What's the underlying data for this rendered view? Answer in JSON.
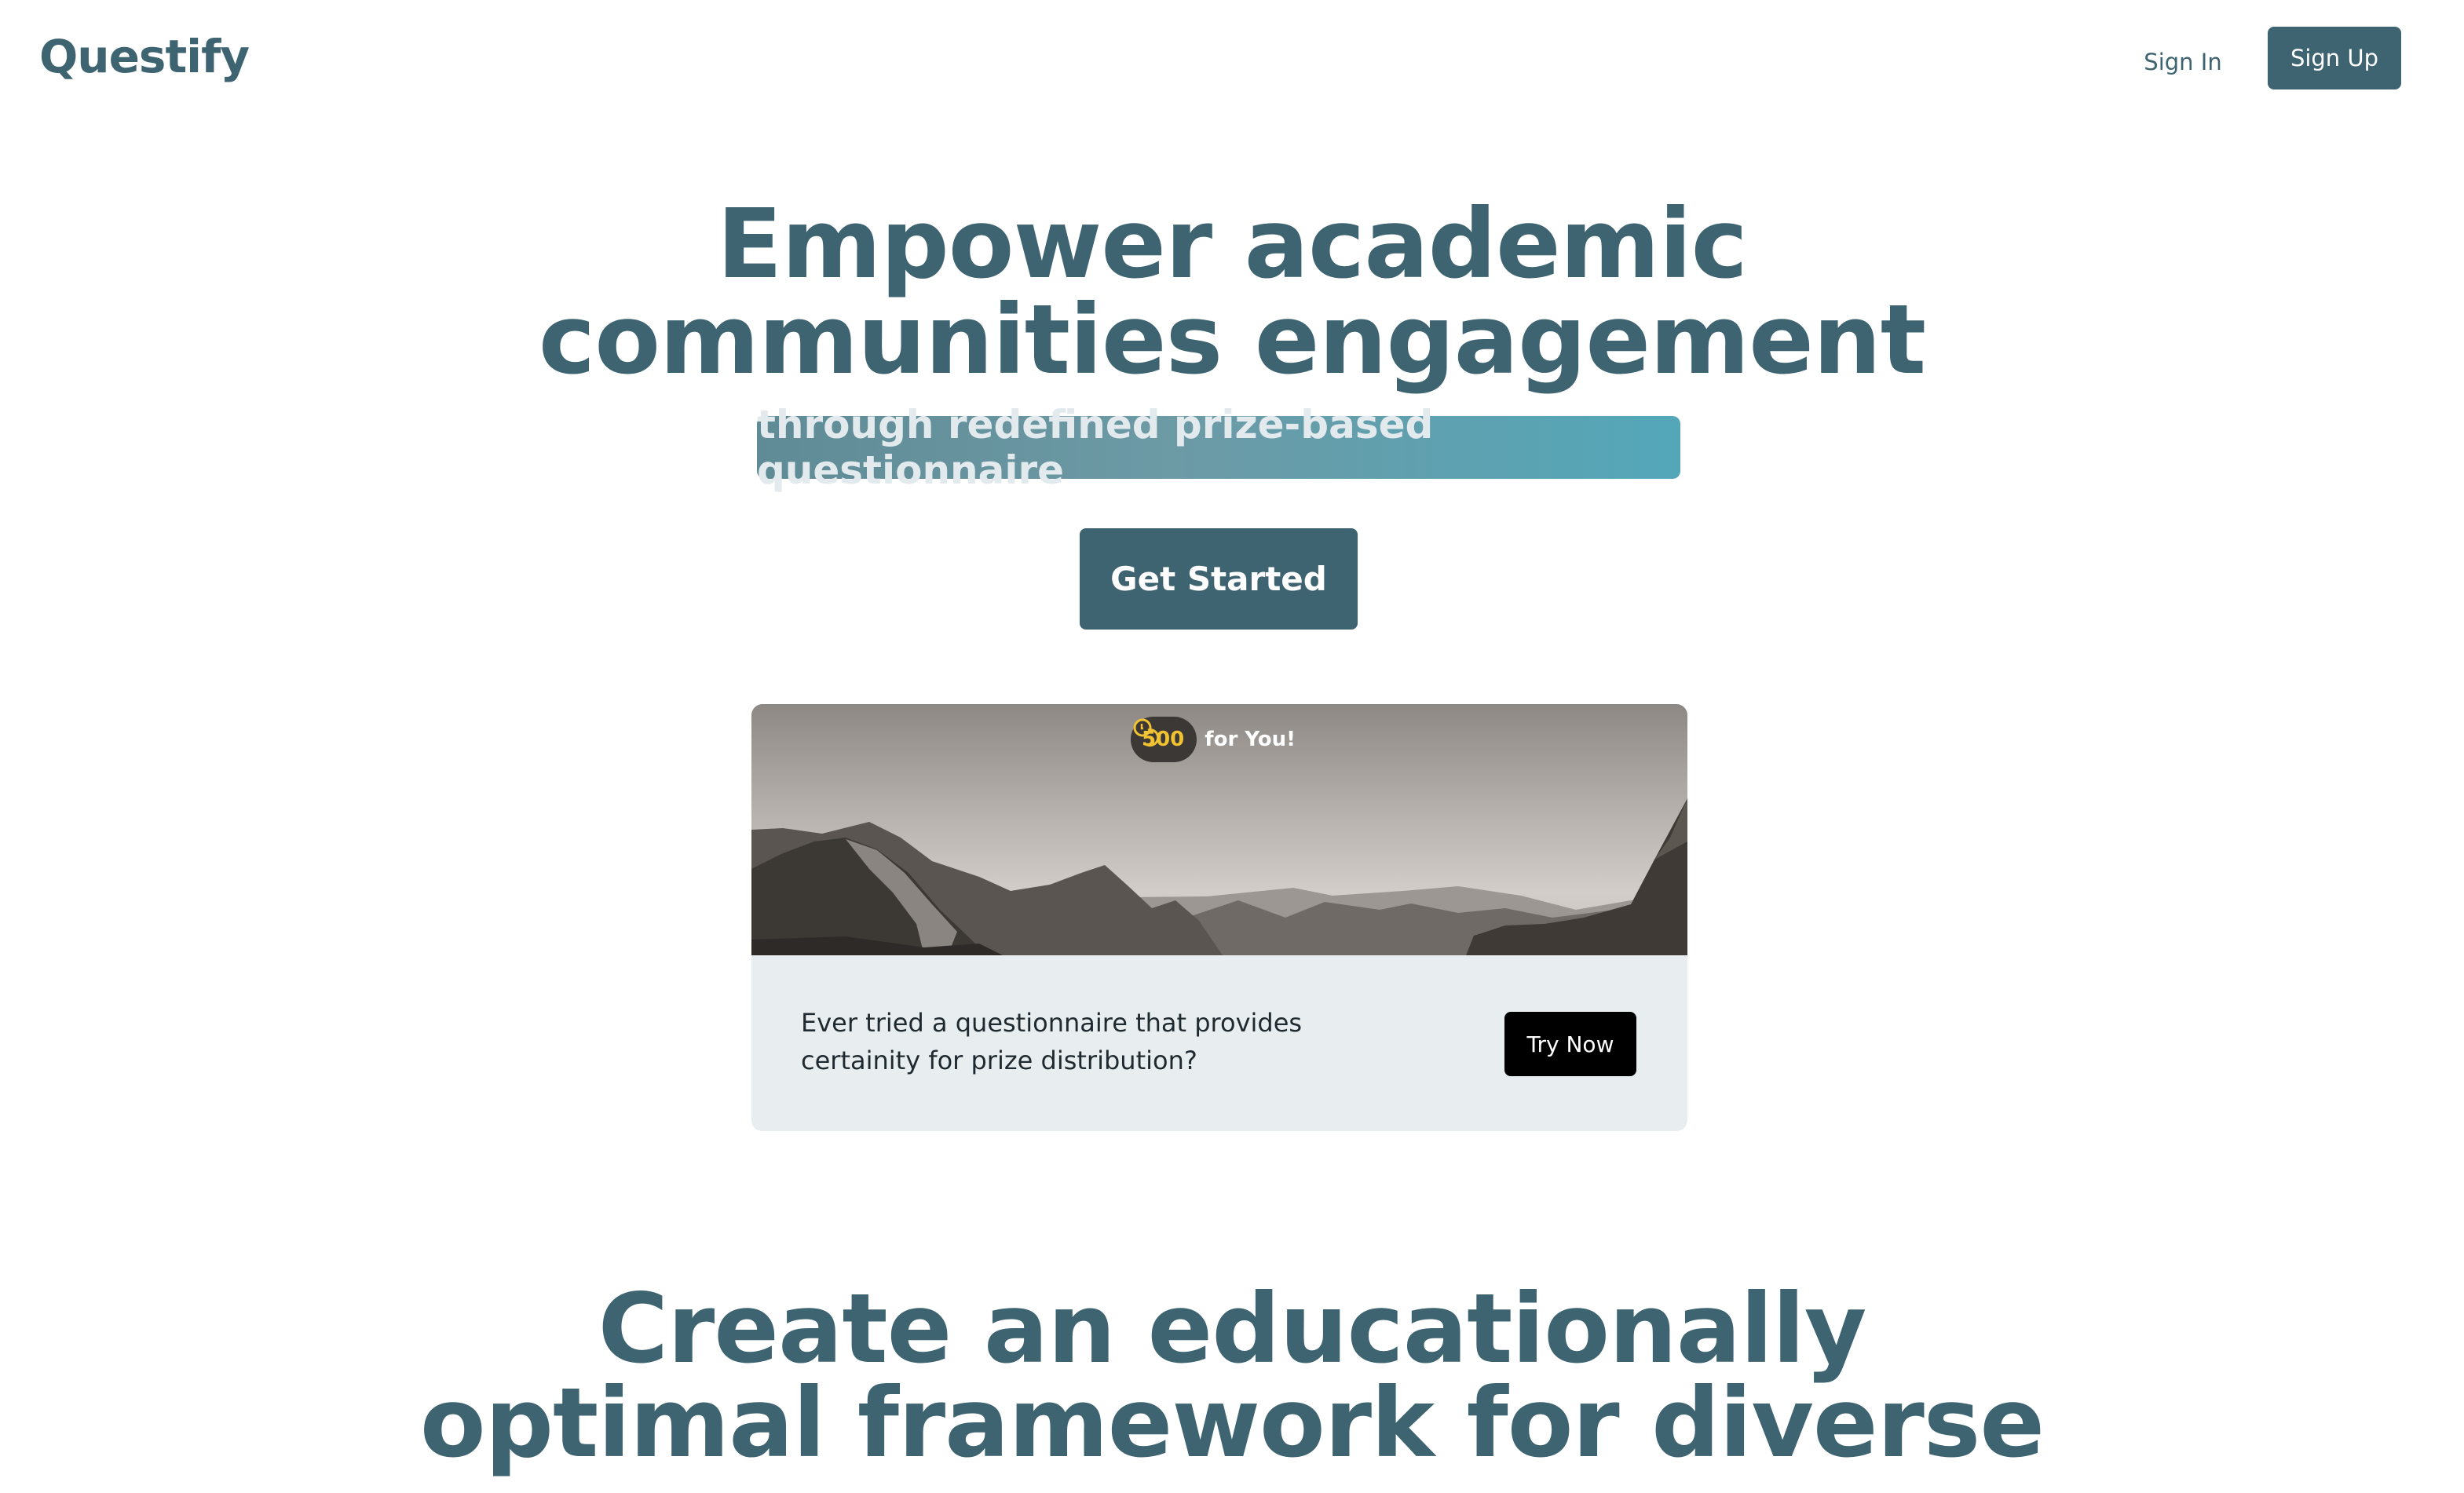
{
  "header": {
    "logo": "Questify",
    "sign_in": "Sign In",
    "sign_up": "Sign Up"
  },
  "hero": {
    "title_line1": "Empower academic",
    "title_line2": "communities engagement",
    "subtitle": "through redefined prize-based questionnaire",
    "cta": "Get Started"
  },
  "card": {
    "reward_amount": "500",
    "reward_text": "for You!",
    "reward_icon": "coins-icon",
    "question": "Ever tried a questionnaire that provides certainity for prize distribution?",
    "button": "Try Now"
  },
  "section2": {
    "title_line1": "Create an educationally",
    "title_line2": "optimal framework for diverse",
    "title_line3": ""
  },
  "colors": {
    "primary": "#3d6470",
    "card_bg": "#e8edef",
    "coin": "#f1c232",
    "gradient_end": "#53a7b9"
  }
}
